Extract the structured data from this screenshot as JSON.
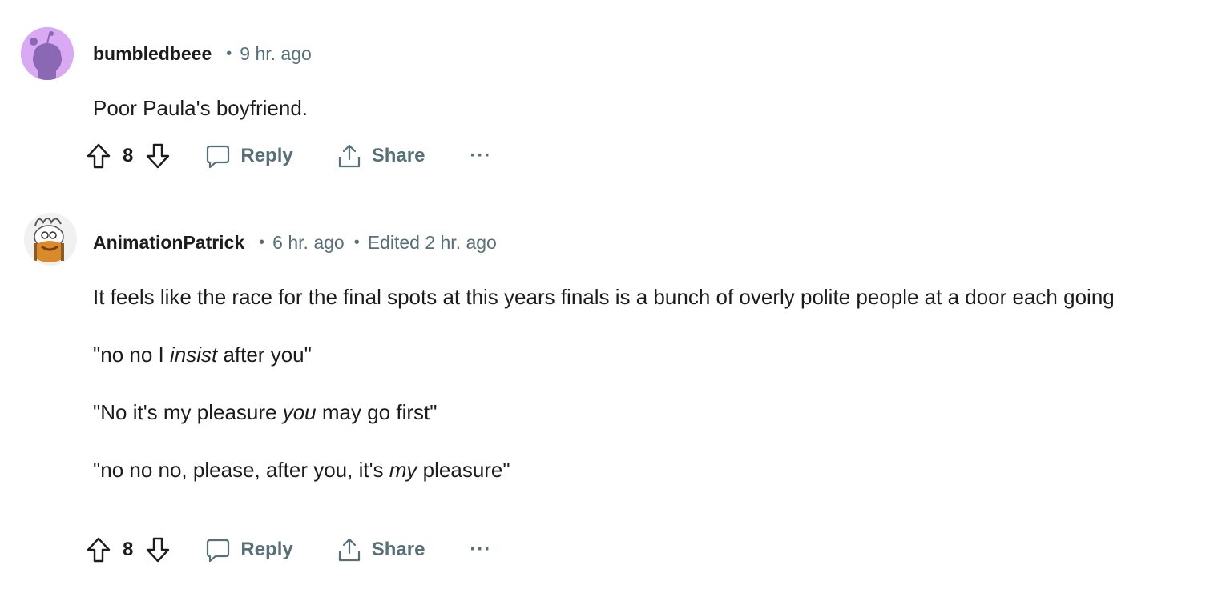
{
  "comments": [
    {
      "username": "bumbledbeee",
      "time": "9 hr. ago",
      "edited": "",
      "body": [
        "Poor Paula's boyfriend."
      ],
      "score": "8",
      "actions": {
        "reply": "Reply",
        "share": "Share",
        "more": "···"
      }
    },
    {
      "username": "AnimationPatrick",
      "time": "6 hr. ago",
      "edited": "Edited 2 hr. ago",
      "body": [
        "It feels like the race for the final spots at this years finals is a bunch of overly polite people at a door each going",
        "\"no no I insist after you\"",
        "\"No it's my pleasure you may go first\"",
        "\"no no no, please, after you, it's my pleasure\""
      ],
      "score": "8",
      "actions": {
        "reply": "Reply",
        "share": "Share",
        "more": "···"
      }
    }
  ],
  "colors": {
    "text": "#1c1c1c",
    "meta": "#576f76",
    "avatar_bg": "#d5a8f0",
    "avatar_fg": "#8b67b6"
  },
  "icons": [
    "upvote-icon",
    "downvote-icon",
    "comment-icon",
    "share-icon",
    "more-icon"
  ]
}
